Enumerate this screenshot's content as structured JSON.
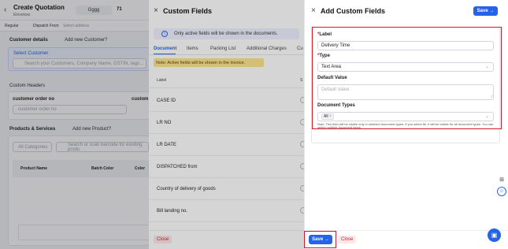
{
  "header": {
    "back_icon": "chevron-left-icon",
    "title": "Create Quotation",
    "subtitle": "Einvoices",
    "party": "Gggg",
    "number": "71"
  },
  "subbar": {
    "mode": "Regular",
    "dispatch_label": "Dispatch From",
    "dispatch_placeholder": "Select address"
  },
  "customer": {
    "details_label": "Customer details",
    "add_new": "Add new Customer?",
    "select_label": "Select Customer",
    "search_placeholder": "Search your Customers, Company Name, GSTIN, tags..."
  },
  "custom_headers": {
    "title": "Custom Headers",
    "field1_label": "customer order no",
    "field1_placeholder": "customer order no",
    "field2_label": "custom"
  },
  "products": {
    "title": "Products & Services",
    "add_new": "Add new Product?",
    "category": "All Categories",
    "search_placeholder": "Search or scan barcode for existing produ",
    "col_name": "Product Name",
    "col_batch": "Batch Color",
    "col_color": "Color"
  },
  "custom_fields_panel": {
    "title": "Custom Fields",
    "info": "Only active fields will be shown in the documents.",
    "tabs": [
      "Document",
      "Items",
      "Packing List",
      "Additional Charges",
      "Cu"
    ],
    "note": "Note: Active fields will be shown in the invoice.",
    "col_label": "Label",
    "col_show": "S",
    "rows": [
      "CASE ID",
      "LR NO",
      "LR DATE",
      "DISPATCHED from",
      "Country of delivery of goods",
      "Bill landing no."
    ],
    "close_label": "Close"
  },
  "add_panel": {
    "title": "Add Custom Fields",
    "save_label": "Save →",
    "label_label": "Label",
    "label_value": "Delivery Time",
    "type_label": "Type",
    "type_value": "Text Area",
    "default_label": "Default Value",
    "default_placeholder": "Default Value",
    "doc_types_label": "Document Types",
    "doc_type_tag": "All",
    "note": "Note: This field will be visible only in selected document types. If you select All, it will be visible for all document types. You can select multiple document types.",
    "close_label": "Close"
  },
  "colors": {
    "accent": "#2563eb",
    "highlight": "#d11a2a"
  }
}
